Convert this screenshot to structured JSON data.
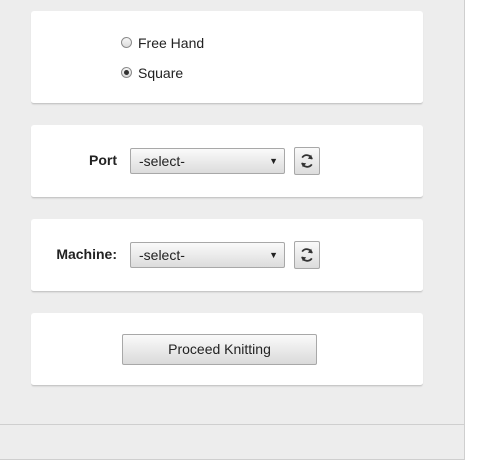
{
  "shape": {
    "options": [
      {
        "label": "Free Hand",
        "checked": false
      },
      {
        "label": "Square",
        "checked": true
      }
    ]
  },
  "port": {
    "label": "Port",
    "selected": "-select-",
    "refresh_icon": "refresh-icon"
  },
  "machine": {
    "label": "Machine:",
    "selected": "-select-",
    "refresh_icon": "refresh-icon"
  },
  "actions": {
    "proceed_label": "Proceed Knitting"
  }
}
